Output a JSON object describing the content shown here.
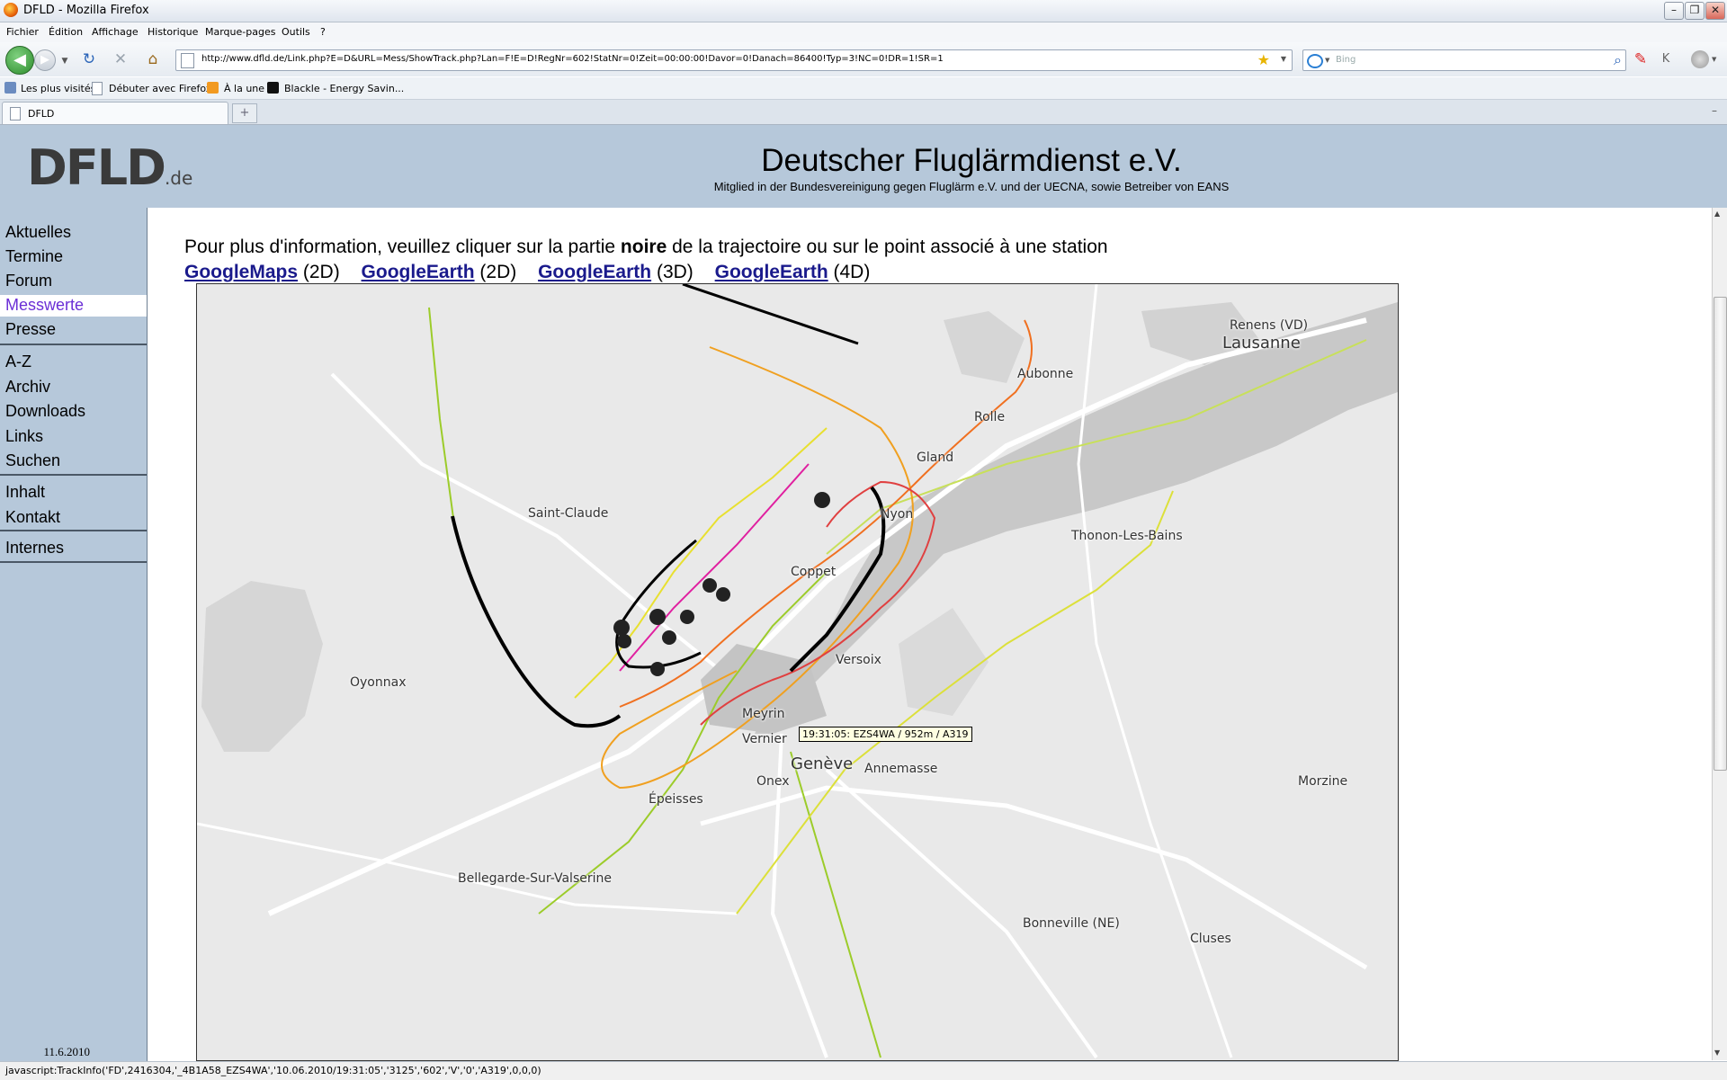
{
  "window": {
    "title": "DFLD - Mozilla Firefox"
  },
  "menu": [
    "Fichier",
    "Édition",
    "Affichage",
    "Historique",
    "Marque-pages",
    "Outils",
    "?"
  ],
  "navigation": {
    "url": "http://www.dfld.de/Link.php?E=D&URL=Mess/ShowTrack.php?Lan=F!E=D!RegNr=602!StatNr=0!Zeit=00:00:00!Davor=0!Danach=86400!Typ=3!NC=0!DR=1!SR=1",
    "search_placeholder": "Bing"
  },
  "bookmarks": [
    "Les plus visités",
    "Débuter avec Firefox",
    "À la une",
    "Blackle - Energy Savin..."
  ],
  "tabs": [
    {
      "label": "DFLD"
    }
  ],
  "site": {
    "logo": "DFLD",
    "logo_suffix": ".de",
    "title": "Deutscher Fluglärmdienst e.V.",
    "subtitle": "Mitglied in der Bundesvereinigung gegen Fluglärm e.V. und der UECNA, sowie Betreiber von EANS"
  },
  "sidebar": {
    "items": [
      "Aktuelles",
      "Termine",
      "Forum",
      "Messwerte",
      "Presse",
      "A-Z",
      "Archiv",
      "Downloads",
      "Links",
      "Suchen",
      "Inhalt",
      "Kontakt",
      "Internes"
    ],
    "active": "Messwerte",
    "date": "11.6.2010"
  },
  "content": {
    "info_prefix": "Pour plus d'information, veuillez cliquer sur la partie ",
    "info_bold": "noire",
    "info_suffix": " de la trajectoire ou sur le point associé à une station",
    "links": [
      {
        "label": "GoogleMaps",
        "suffix": "(2D)"
      },
      {
        "label": "GoogleEarth",
        "suffix": "(2D)"
      },
      {
        "label": "GoogleEarth",
        "suffix": "(3D)"
      },
      {
        "label": "GoogleEarth",
        "suffix": "(4D)"
      }
    ]
  },
  "map": {
    "places": [
      "Renens (VD)",
      "Lausanne",
      "Aubonne",
      "Rolle",
      "Gland",
      "Nyon",
      "Saint-Claude",
      "Thonon-Les-Bains",
      "Oyonnax",
      "Coppet",
      "Versoix",
      "Meyrin",
      "Vernier",
      "Genève",
      "Annemasse",
      "Onex",
      "Épeisses",
      "Bellegarde-Sur-Valserine",
      "Morzine",
      "Bonneville (NE)",
      "Cluses"
    ],
    "tooltip": "19:31:05: EZS4WA / 952m / A319"
  },
  "status": "javascript:TrackInfo('FD',2416304,'_4B1A58_EZS4WA','10.06.2010/19:31:05','3125','602','V','0','A319',0,0,0)"
}
